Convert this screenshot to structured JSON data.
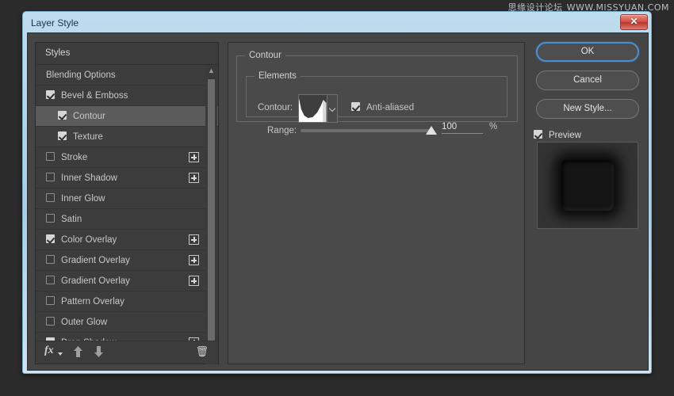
{
  "watermark": {
    "cn": "思缘设计论坛",
    "url": "WWW.MISSYUAN.COM"
  },
  "window": {
    "title": "Layer Style",
    "close_label": "✕"
  },
  "styles_panel": {
    "header": "Styles",
    "rows": [
      {
        "label": "Blending Options",
        "checkbox": "none",
        "indent": false,
        "plus": false,
        "selected": false
      },
      {
        "label": "Bevel & Emboss",
        "checkbox": "checked",
        "indent": false,
        "plus": false,
        "selected": false
      },
      {
        "label": "Contour",
        "checkbox": "checked",
        "indent": true,
        "plus": false,
        "selected": true
      },
      {
        "label": "Texture",
        "checkbox": "checked",
        "indent": true,
        "plus": false,
        "selected": false
      },
      {
        "label": "Stroke",
        "checkbox": "unchecked",
        "indent": false,
        "plus": true,
        "selected": false
      },
      {
        "label": "Inner Shadow",
        "checkbox": "unchecked",
        "indent": false,
        "plus": true,
        "selected": false
      },
      {
        "label": "Inner Glow",
        "checkbox": "unchecked",
        "indent": false,
        "plus": false,
        "selected": false
      },
      {
        "label": "Satin",
        "checkbox": "unchecked",
        "indent": false,
        "plus": false,
        "selected": false
      },
      {
        "label": "Color Overlay",
        "checkbox": "checked",
        "indent": false,
        "plus": true,
        "selected": false
      },
      {
        "label": "Gradient Overlay",
        "checkbox": "unchecked",
        "indent": false,
        "plus": true,
        "selected": false
      },
      {
        "label": "Gradient Overlay",
        "checkbox": "unchecked",
        "indent": false,
        "plus": true,
        "selected": false
      },
      {
        "label": "Pattern Overlay",
        "checkbox": "unchecked",
        "indent": false,
        "plus": false,
        "selected": false
      },
      {
        "label": "Outer Glow",
        "checkbox": "unchecked",
        "indent": false,
        "plus": false,
        "selected": false
      },
      {
        "label": "Drop Shadow",
        "checkbox": "checked",
        "indent": false,
        "plus": true,
        "selected": false
      }
    ],
    "toolbar": {
      "fx": "fx",
      "move_up": "move-up",
      "move_down": "move-down",
      "delete": "🗑"
    },
    "scrollbar": {
      "up": "▲",
      "down": "▼"
    }
  },
  "settings": {
    "group_title": "Contour",
    "subgroup_title": "Elements",
    "contour_label": "Contour:",
    "antialiased_label": "Anti-aliased",
    "antialiased_checked": true,
    "range_label": "Range:",
    "range_value": "100",
    "range_unit": "%"
  },
  "actions": {
    "ok": "OK",
    "cancel": "Cancel",
    "new_style": "New Style...",
    "preview": "Preview",
    "preview_checked": true
  },
  "colors": {
    "accent": "#4a8fd0",
    "panel": "#454545",
    "list": "#3c3c3c",
    "selected_row": "#5b5b5b",
    "close_red": "#cf4d42"
  }
}
